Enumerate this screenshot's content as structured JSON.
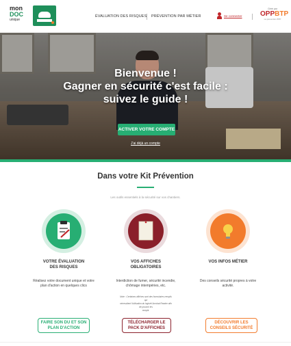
{
  "header": {
    "logo": {
      "line1": "mon",
      "line2": "DOC",
      "line3": "unique"
    },
    "nav": [
      "ÉVALUATION DES RISQUES",
      "PRÉVENTION PAR MÉTIER"
    ],
    "login_label": "Se connecter",
    "partner": {
      "small": "Géré par",
      "name_a": "OPP",
      "name_b": "BTP",
      "tagline": "La prévention BTP"
    }
  },
  "hero": {
    "title_line1": "Bienvenue !",
    "title_line2": "Gagner en sécurité c'est facile :",
    "title_line3": "suivez le guide !",
    "cta_label": "ACTIVER VOTRE COMPTE",
    "already_label": "J'ai déjà un compte"
  },
  "kit": {
    "title": "Dans votre Kit Prévention",
    "subtitle": "Les outils essentiels à la sécurité sur vos chantiers.",
    "columns": [
      {
        "title_line1": "VOTRE ÉVALUATION",
        "title_line2": "DES RISQUES",
        "desc_line1": "Réalisez votre document unique et votre",
        "desc_line2": "plan d'action en quelques clics",
        "button_line1": "FAIRE SON DU ET SON",
        "button_line2": "PLAN D'ACTION",
        "icon": "clipboard-icon",
        "color": "#27ae73"
      },
      {
        "title_line1": "VOS AFFICHES",
        "title_line2": "OBLIGATOIRES",
        "desc_line1": "Interdiction de fumer, sécurité incendie,",
        "desc_line2": "chômage intempéries, etc.",
        "button_line1": "TÉLÉCHARGER LE",
        "button_line2": "PACK D'AFFICHES",
        "icon": "poster-icon",
        "color": "#8a1f2a"
      },
      {
        "title_line1": "VOS INFOS MÉTIER",
        "title_line2": "",
        "desc_line1": "Des conseils sécurité propres à votre",
        "desc_line2": "activité.",
        "button_line1": "DÉCOUVRIR LES",
        "button_line2": "CONSEILS SÉCURITÉ",
        "icon": "lightbulb-icon",
        "color": "#f27b2c"
      }
    ],
    "note_line1": "Note : Certaines affiches sont des formulaires remplis qui",
    "note_line2": "nécessitent l'utilisation du logiciel Acrobat Reader afin de pouvoir les",
    "note_line3": "remplir."
  }
}
